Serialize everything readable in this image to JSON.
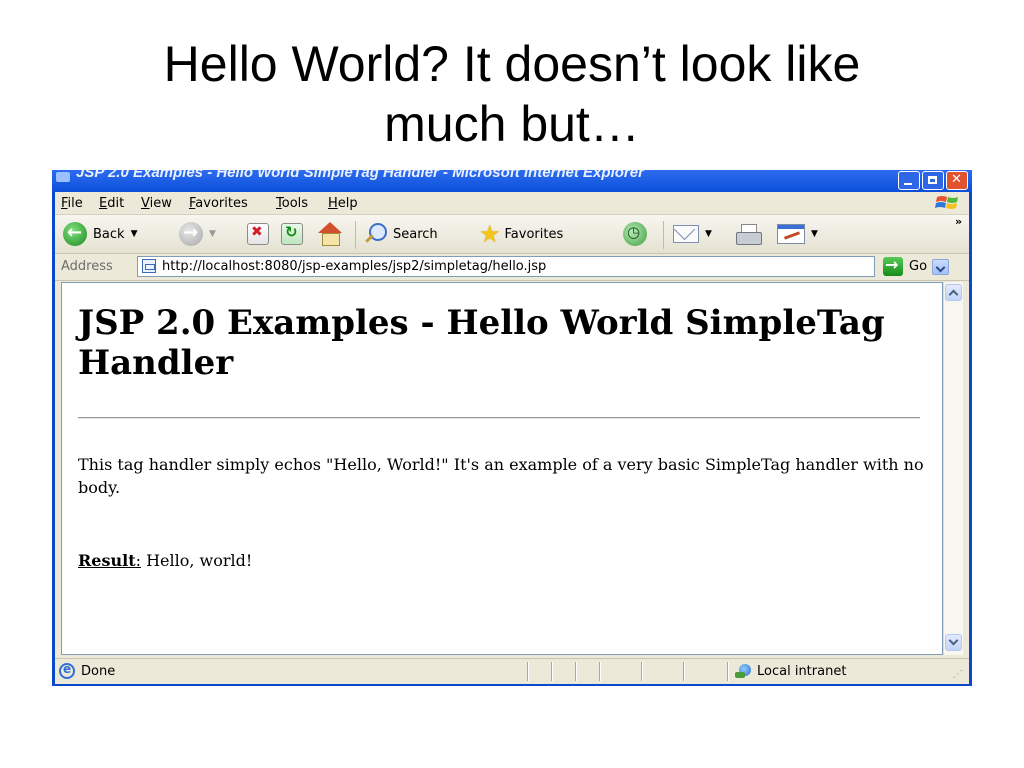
{
  "slide": {
    "title_line1": "Hello World? It doesn’t look like",
    "title_line2": "much but…"
  },
  "window": {
    "title": "JSP 2.0 Examples - Hello World SimpleTag Handler - Microsoft Internet Explorer"
  },
  "menubar": {
    "items": [
      "File",
      "Edit",
      "View",
      "Favorites",
      "Tools",
      "Help"
    ]
  },
  "toolbar": {
    "back_label": "Back",
    "search_label": "Search",
    "favorites_label": "Favorites",
    "overflow": "»"
  },
  "addressbar": {
    "label": "Address",
    "url": "http://localhost:8080/jsp-examples/jsp2/simpletag/hello.jsp",
    "go_label": "Go"
  },
  "page": {
    "heading": "JSP 2.0 Examples - Hello World SimpleTag Handler",
    "description": "This tag handler simply echos \"Hello, World!\" It's an example of a very basic SimpleTag handler with no body.",
    "result_label": "Result",
    "result_colon": ":",
    "result_value": " Hello, world!"
  },
  "statusbar": {
    "status": "Done",
    "zone": "Local intranet"
  }
}
